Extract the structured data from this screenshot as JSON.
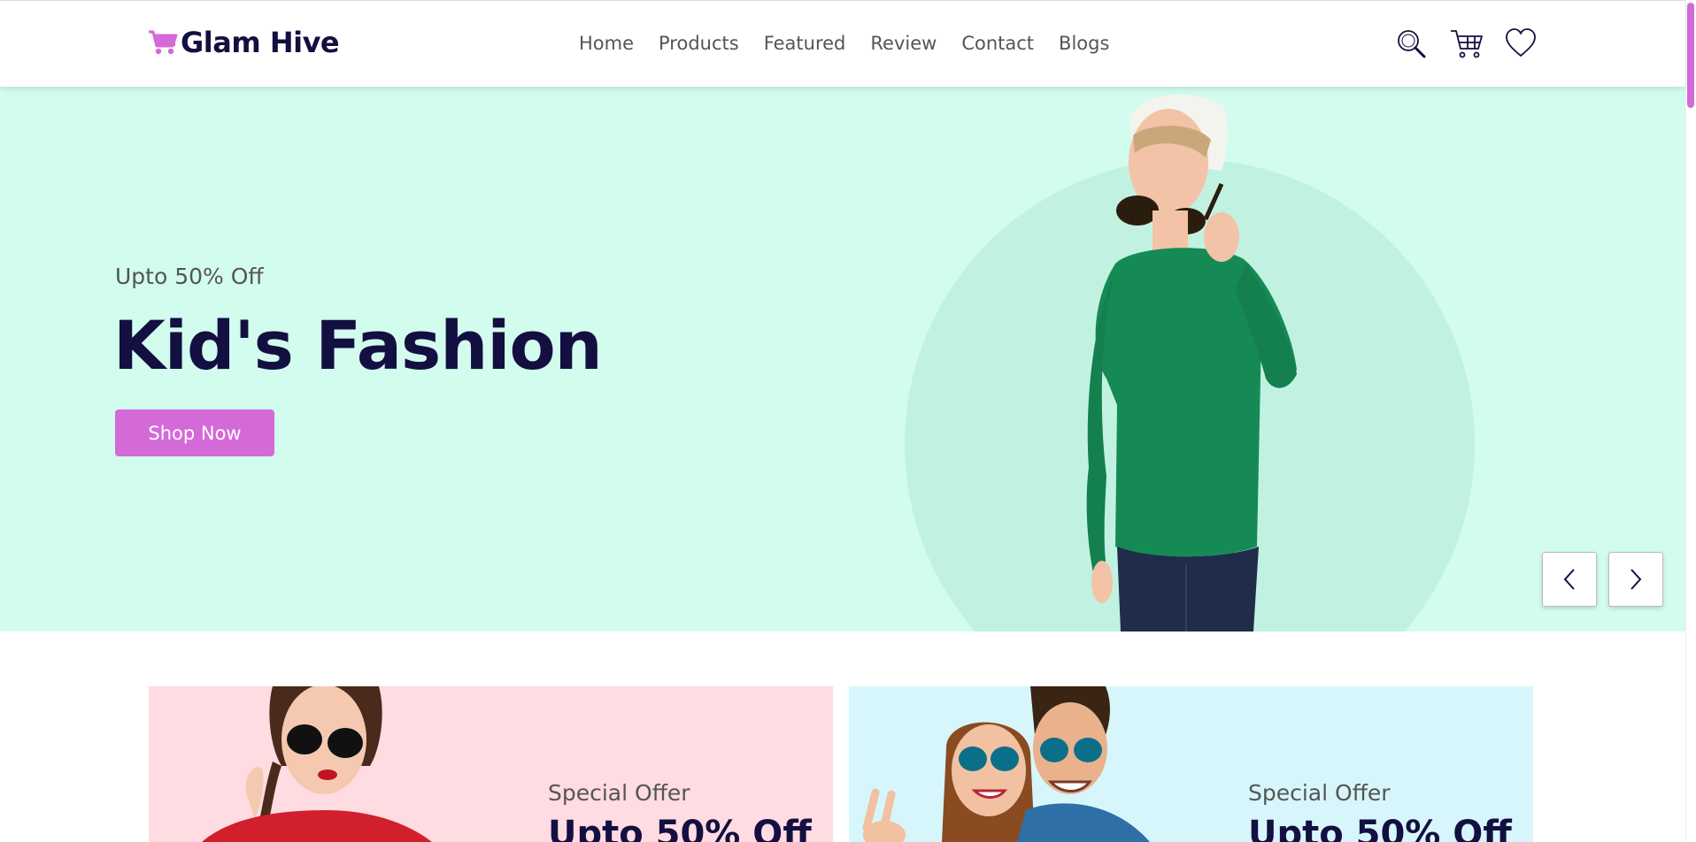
{
  "brand": {
    "name": "Glam Hive",
    "logo_icon": "cart-icon",
    "accent_color": "#d46ad8",
    "text_color": "#130f40"
  },
  "nav": {
    "items": [
      "Home",
      "Products",
      "Featured",
      "Review",
      "Contact",
      "Blogs"
    ]
  },
  "header_icons": [
    "search-icon",
    "cart-icon",
    "heart-icon"
  ],
  "hero": {
    "subtitle": "Upto 50% Off",
    "title": "Kid's Fashion",
    "cta": "Shop Now",
    "background_color": "#d2fcee"
  },
  "slider": {
    "prev_icon": "chevron-left-icon",
    "next_icon": "chevron-right-icon"
  },
  "offers": [
    {
      "label": "Special Offer",
      "title": "Upto 50% Off",
      "background_color": "#ffdbe2"
    },
    {
      "label": "Special Offer",
      "title": "Upto 50% Off",
      "background_color": "#d6f6fb"
    }
  ]
}
